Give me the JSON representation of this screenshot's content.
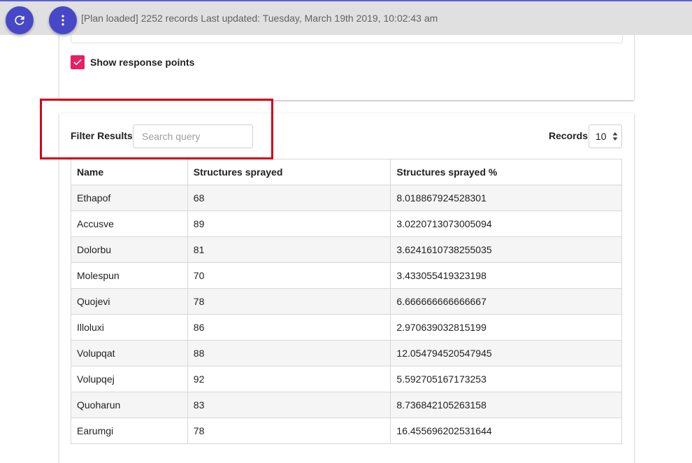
{
  "header": {
    "status_text": "[Plan loaded] 2252 records Last updated: Tuesday, March 19th 2019, 10:02:43 am",
    "refresh_icon": "refresh-icon",
    "menu_icon": "more-vertical-icon",
    "accent_color": "#4748c7"
  },
  "options": {
    "show_response_points_label": "Show response points",
    "show_response_points_checked": true,
    "checkbox_color": "#e91e63"
  },
  "filter": {
    "label": "Filter Results:",
    "search_placeholder": "Search query",
    "search_value": ""
  },
  "records": {
    "label": "Records:",
    "selected": "10"
  },
  "table": {
    "columns": [
      "Name",
      "Structures sprayed",
      "Structures sprayed %"
    ],
    "rows": [
      [
        "Ethapof",
        "68",
        "8.018867924528301"
      ],
      [
        "Accusve",
        "89",
        "3.0220713073005094"
      ],
      [
        "Dolorbu",
        "81",
        "3.6241610738255035"
      ],
      [
        "Molespun",
        "70",
        "3.433055419323198"
      ],
      [
        "Quojevi",
        "78",
        "6.666666666666667"
      ],
      [
        "Illoluxi",
        "86",
        "2.970639032815199"
      ],
      [
        "Volupqat",
        "88",
        "12.054794520547945"
      ],
      [
        "Volupqej",
        "92",
        "5.592705167173253"
      ],
      [
        "Quoharun",
        "83",
        "8.736842105263158"
      ],
      [
        "Earumgi",
        "78",
        "16.455696202531644"
      ]
    ]
  },
  "highlight_color": "#d0021b"
}
